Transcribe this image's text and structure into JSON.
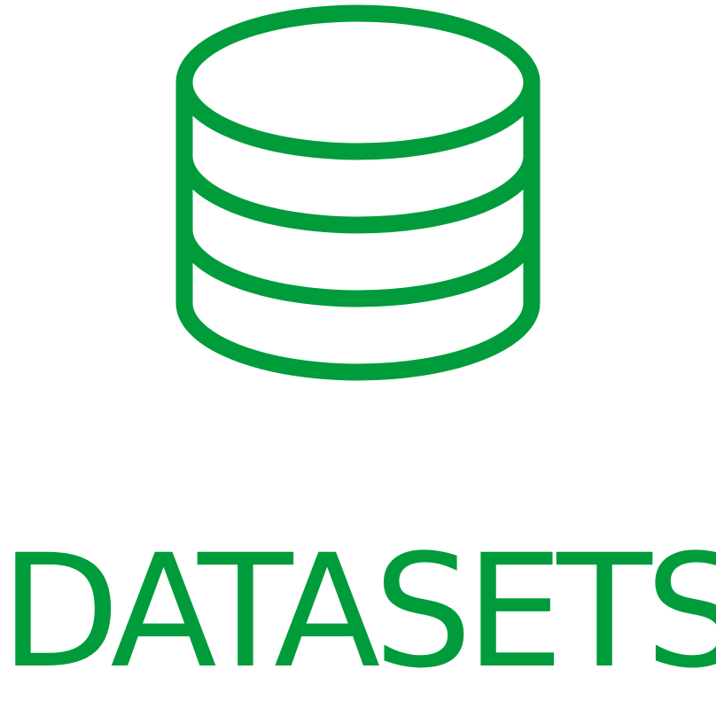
{
  "label": "DATASETS",
  "icon": "database-icon",
  "colors": {
    "accent": "#009c3b",
    "background": "#ffffff"
  }
}
